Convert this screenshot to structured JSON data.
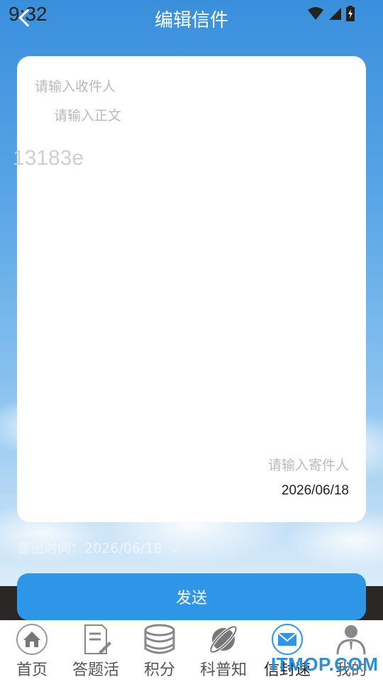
{
  "status": {
    "time": "9:32"
  },
  "header": {
    "title": "编辑信件"
  },
  "letter": {
    "recipient_placeholder": "请输入收件人",
    "body_placeholder": "请输入正文",
    "code": "13183e",
    "sender_placeholder": "请输入寄件人",
    "date": "2026/06/18"
  },
  "send_time": {
    "label": "寄出时间：2026/06/18"
  },
  "send_button": {
    "label": "发送"
  },
  "tabs": [
    {
      "label": "首页",
      "icon": "home-icon"
    },
    {
      "label": "答题活",
      "icon": "quiz-icon"
    },
    {
      "label": "积分",
      "icon": "coins-icon"
    },
    {
      "label": "科普知",
      "icon": "science-icon"
    },
    {
      "label": "信封速",
      "icon": "mail-icon",
      "active": true
    },
    {
      "label": "我的",
      "icon": "user-icon"
    }
  ],
  "watermark": {
    "text": "ITMOP.COM"
  },
  "colors": {
    "accent": "#2f95e6",
    "sky": "#3a8fdc"
  }
}
